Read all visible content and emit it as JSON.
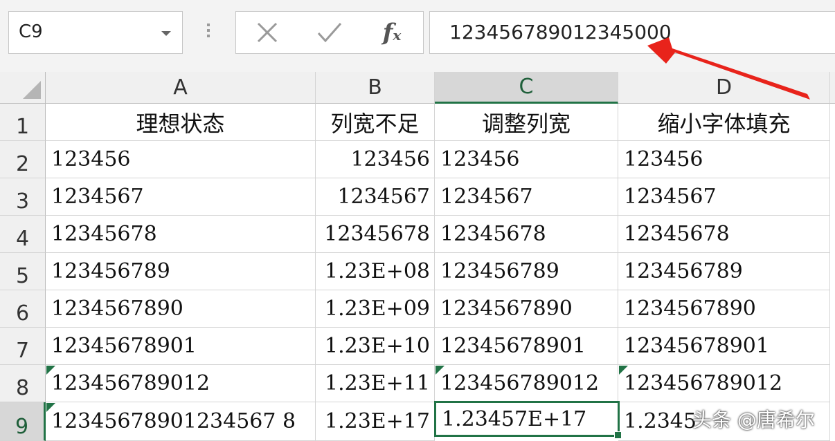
{
  "formula_bar": {
    "name_box": "C9",
    "cancel_icon": "cross-icon",
    "enter_icon": "check-icon",
    "function_label": "fx",
    "formula_value": "123456789012345000"
  },
  "columns": [
    "A",
    "B",
    "C",
    "D"
  ],
  "selected_column": "C",
  "rows": [
    "1",
    "2",
    "3",
    "4",
    "5",
    "6",
    "7",
    "8",
    "9"
  ],
  "selected_row": "9",
  "cells": {
    "r1": [
      "理想状态",
      "列宽不足",
      "调整列宽",
      "缩小字体填充"
    ],
    "r2": [
      "123456",
      "123456",
      "123456",
      "123456"
    ],
    "r3": [
      "1234567",
      "1234567",
      "1234567",
      "1234567"
    ],
    "r4": [
      "12345678",
      "12345678",
      "12345678",
      "12345678"
    ],
    "r5": [
      "123456789",
      "1.23E+08",
      "123456789",
      "123456789"
    ],
    "r6": [
      "1234567890",
      "1.23E+09",
      "1234567890",
      "1234567890"
    ],
    "r7": [
      "12345678901",
      "1.23E+10",
      "12345678901",
      "12345678901"
    ],
    "r8": [
      "123456789012",
      "1.23E+11",
      "123456789012",
      "123456789012"
    ],
    "r9": [
      "12345678901234567 8",
      "1.23E+17",
      "1.23457E+17",
      "1.2345"
    ]
  },
  "watermark": "头条 @唐希尔",
  "colors": {
    "accent": "#217346",
    "arrow": "#e8231b"
  }
}
